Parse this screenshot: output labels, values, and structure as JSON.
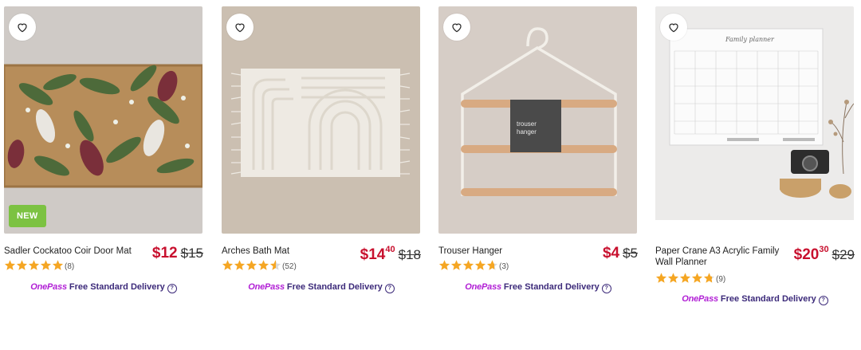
{
  "products": [
    {
      "title": "Sadler Cockatoo Coir Door Mat",
      "price_dollars": "$12",
      "price_cents": "",
      "was_price": "$15",
      "rating_count": "(8)",
      "badge": "NEW"
    },
    {
      "title": "Arches Bath Mat",
      "price_dollars": "$14",
      "price_cents": "40",
      "was_price": "$18",
      "rating_count": "(52)",
      "badge": ""
    },
    {
      "title": "Trouser Hanger",
      "price_dollars": "$4",
      "price_cents": "",
      "was_price": "$5",
      "rating_count": "(3)",
      "badge": "",
      "tag_line1": "trouser",
      "tag_line2": "hanger"
    },
    {
      "title": "Paper Crane A3 Acrylic Family Wall Planner",
      "price_dollars": "$20",
      "price_cents": "30",
      "was_price": "$29",
      "rating_count": "(9)",
      "badge": "",
      "planner_heading": "Family planner"
    }
  ],
  "delivery": {
    "brand": "OnePass",
    "label": "Free Standard Delivery",
    "help": "?"
  },
  "colors": {
    "price_red": "#c8102e",
    "star_gold": "#f5a623",
    "onepass_purple": "#b11fd5",
    "delivery_text": "#3c2a7a",
    "new_badge": "#7cc242"
  },
  "icons": {
    "wishlist": "heart-outline-icon",
    "rating": "star-icon",
    "help": "question-circle-icon"
  }
}
